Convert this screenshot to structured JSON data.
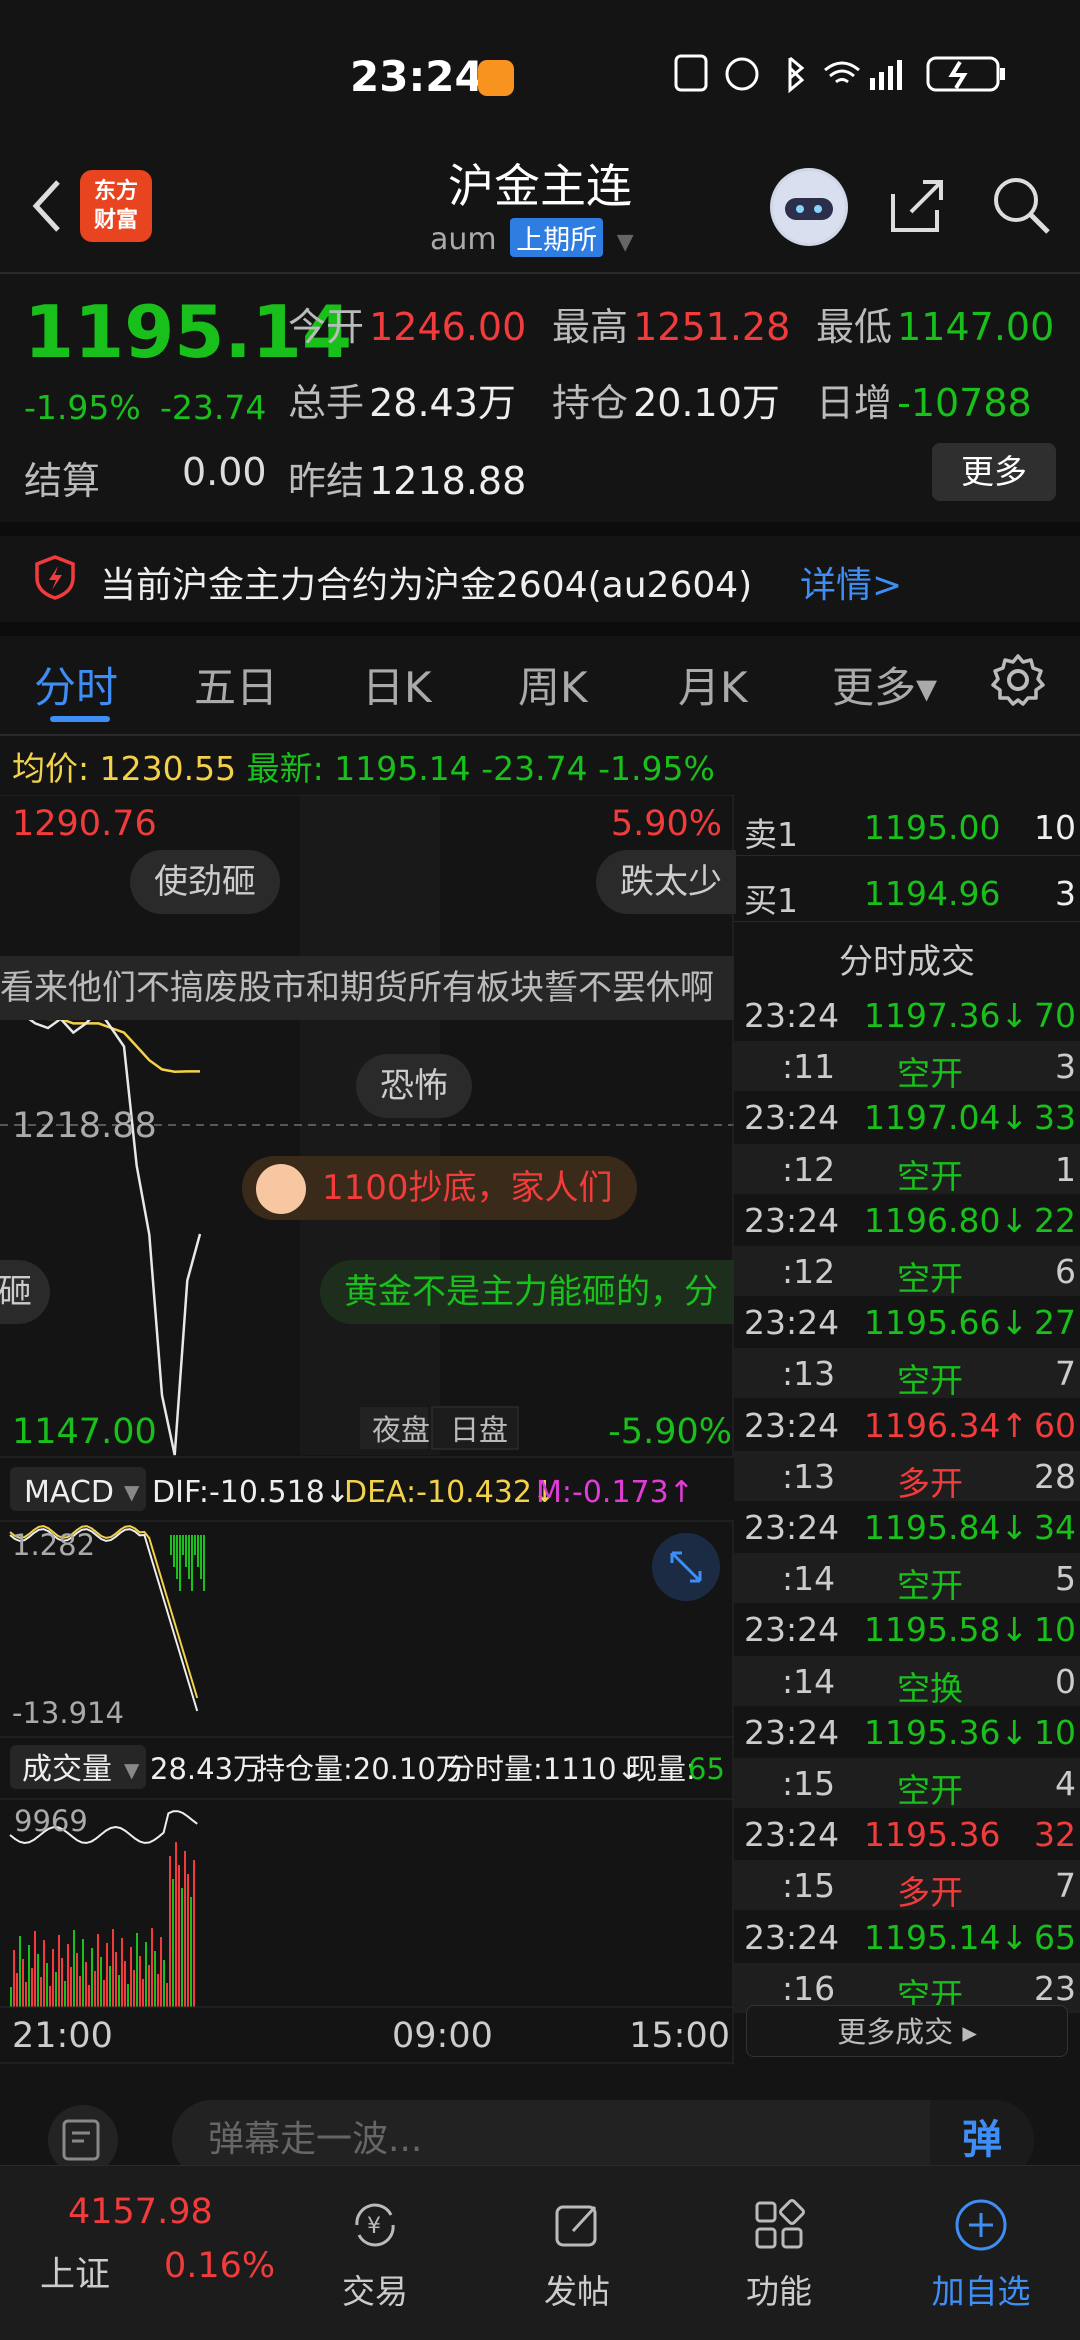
{
  "status_bar": {
    "time": "23:24",
    "icons": "NFC alarm bluetooth wifi 5G signal battery-charging"
  },
  "header": {
    "title": "沪金主连",
    "symbol": "aum",
    "exchange": "上期所",
    "logo_text_1": "东方",
    "logo_text_2": "财富"
  },
  "quote": {
    "last_price": "1195.14",
    "change_pct": "-1.95%",
    "change_abs": "-23.74",
    "open_label": "今开",
    "open": "1246.00",
    "high_label": "最高",
    "high": "1251.28",
    "low_label": "最低",
    "low": "1147.00",
    "volume_label": "总手",
    "volume": "28.43万",
    "oi_label": "持仓",
    "oi": "20.10万",
    "oi_change_label": "日增",
    "oi_change": "-10788",
    "settle_label": "结算",
    "settle": "0.00",
    "prev_settle_label": "昨结",
    "prev_settle": "1218.88",
    "more_label": "更多"
  },
  "notice": {
    "text": "当前沪金主力合约为沪金2604(au2604)",
    "link": "详情>"
  },
  "tabs": [
    "分时",
    "五日",
    "日K",
    "周K",
    "月K",
    "更多▾"
  ],
  "avg_bar": {
    "avg_label": "均价:",
    "avg": "1230.55",
    "latest_label": "最新:",
    "latest": "1195.14",
    "change": "-23.74",
    "pct": "-1.95%"
  },
  "chart": {
    "price_high": "1290.76",
    "price_mid": "1218.88",
    "price_low": "1147.00",
    "pct_high": "5.90%",
    "pct_low": "-5.90%",
    "session_night": "夜盘",
    "session_day": "日盘",
    "time_labels": [
      "21:00",
      "09:00",
      "15:00"
    ],
    "macd": {
      "selector": "MACD",
      "dif": "DIF:-10.518↓",
      "dea": "DEA:-10.432↓",
      "m": "M:-0.173↑",
      "top": "1.282",
      "bottom": "-13.914"
    },
    "volume": {
      "selector": "成交量",
      "total": "28.43万",
      "oi": "持仓量:20.10万",
      "minute": "分时量:1110↓",
      "current_label": "现量:",
      "current": "65",
      "top": "9969"
    }
  },
  "bubbles": [
    "使劲砸",
    "跌太少",
    "看来他们不搞废股市和期货所有板块誓不罢休啊",
    "恐怖",
    "1100抄底，家人们",
    "砸",
    "黄金不是主力能砸的，分"
  ],
  "chart_data": {
    "type": "line",
    "title": "",
    "x": [
      "21:00",
      "09:00",
      "15:00"
    ],
    "ylim": [
      1147.0,
      1290.76
    ],
    "reference": 1218.88,
    "series": [
      {
        "name": "",
        "values": [
          1245,
          1243,
          1241,
          1240,
          1242,
          1239,
          1241,
          1244,
          1240,
          1236,
          1210,
          1195,
          1160,
          1147,
          1185,
          1195.14
        ]
      },
      {
        "name": "均价",
        "values": [
          1246,
          1244,
          1243,
          1242,
          1242,
          1241,
          1241,
          1241,
          1240,
          1239,
          1236,
          1233,
          1231,
          1230.5,
          1230.55,
          1230.55
        ]
      }
    ]
  },
  "order_book": {
    "ask_label": "卖1",
    "ask_price": "1195.00",
    "ask_vol": "10",
    "bid_label": "买1",
    "bid_price": "1194.96",
    "bid_vol": "3"
  },
  "time_sales": {
    "title": "分时成交",
    "rows": [
      {
        "time": "23:24",
        "price": "1197.36↓",
        "vol": "70",
        "dir": "down"
      },
      {
        "time": ":11",
        "price": "空开",
        "vol": "3",
        "dir": "down",
        "type": true
      },
      {
        "time": "23:24",
        "price": "1197.04↓",
        "vol": "33",
        "dir": "down"
      },
      {
        "time": ":12",
        "price": "空开",
        "vol": "1",
        "dir": "down",
        "type": true
      },
      {
        "time": "23:24",
        "price": "1196.80↓",
        "vol": "22",
        "dir": "down"
      },
      {
        "time": ":12",
        "price": "空开",
        "vol": "6",
        "dir": "down",
        "type": true
      },
      {
        "time": "23:24",
        "price": "1195.66↓",
        "vol": "27",
        "dir": "down"
      },
      {
        "time": ":13",
        "price": "空开",
        "vol": "7",
        "dir": "down",
        "type": true
      },
      {
        "time": "23:24",
        "price": "1196.34↑",
        "vol": "60",
        "dir": "up"
      },
      {
        "time": ":13",
        "price": "多开",
        "vol": "28",
        "dir": "up",
        "type": true
      },
      {
        "time": "23:24",
        "price": "1195.84↓",
        "vol": "34",
        "dir": "down"
      },
      {
        "time": ":14",
        "price": "空开",
        "vol": "5",
        "dir": "down",
        "type": true
      },
      {
        "time": "23:24",
        "price": "1195.58↓",
        "vol": "10",
        "dir": "down"
      },
      {
        "time": ":14",
        "price": "空换",
        "vol": "0",
        "dir": "down",
        "type": true
      },
      {
        "time": "23:24",
        "price": "1195.36↓",
        "vol": "10",
        "dir": "down"
      },
      {
        "time": ":15",
        "price": "空开",
        "vol": "4",
        "dir": "down",
        "type": true
      },
      {
        "time": "23:24",
        "price": "1195.36",
        "vol": "32",
        "dir": "up"
      },
      {
        "time": ":15",
        "price": "多开",
        "vol": "7",
        "dir": "up",
        "type": true
      },
      {
        "time": "23:24",
        "price": "1195.14↓",
        "vol": "65",
        "dir": "down"
      },
      {
        "time": ":16",
        "price": "空开",
        "vol": "23",
        "dir": "down",
        "type": true
      }
    ],
    "more": "更多成交 ▸"
  },
  "comment": {
    "placeholder": "弹幕走一波...",
    "danmaku": "弹"
  },
  "bottom_nav": {
    "index_price": "4157.98",
    "index_name": "上证",
    "index_pct": "0.16%",
    "items": [
      "交易",
      "发帖",
      "功能",
      "加自选"
    ]
  },
  "colors": {
    "up": "#f23c3c",
    "down": "#19c01b",
    "accent": "#3f8ef5",
    "avg": "#f3d24a"
  }
}
